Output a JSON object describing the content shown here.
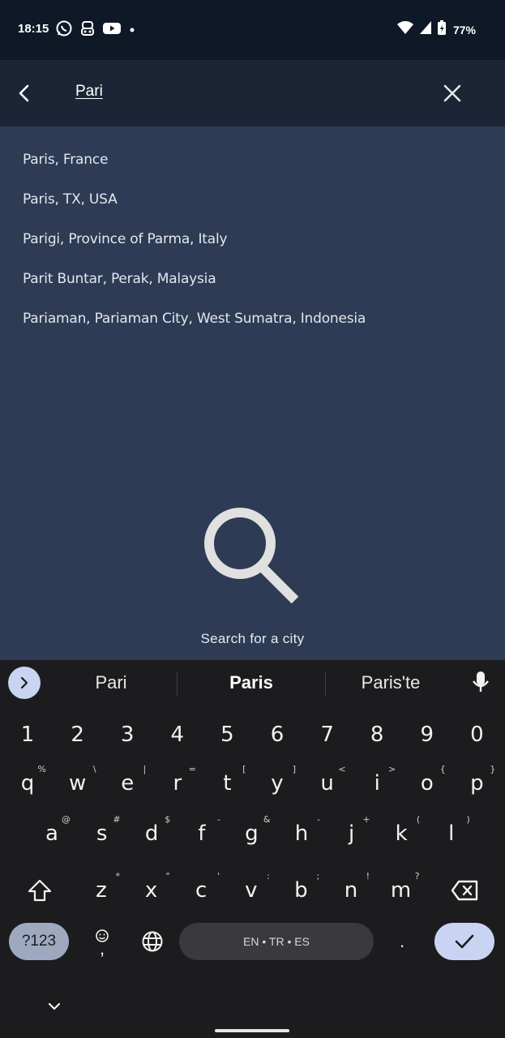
{
  "status_bar": {
    "time": "18:15",
    "battery": "77%",
    "left_icons": [
      "whatsapp-icon",
      "incognito-icon",
      "youtube-icon",
      "dot-icon"
    ],
    "right_icons": [
      "wifi-icon",
      "signal-icon",
      "battery-charging-icon"
    ]
  },
  "search": {
    "query": "Pari"
  },
  "results": [
    "Paris, France",
    "Paris, TX, USA",
    "Parigi, Province of Parma, Italy",
    "Parit Buntar, Perak, Malaysia",
    "Pariaman, Pariaman City, West Sumatra, Indonesia"
  ],
  "empty_state": {
    "text": "Search for a city"
  },
  "keyboard": {
    "suggestions": [
      "Pari",
      "Paris",
      "Paris'te"
    ],
    "numbers": [
      "1",
      "2",
      "3",
      "4",
      "5",
      "6",
      "7",
      "8",
      "9",
      "0"
    ],
    "row1": [
      {
        "k": "q",
        "h": "%"
      },
      {
        "k": "w",
        "h": "\\"
      },
      {
        "k": "e",
        "h": "|"
      },
      {
        "k": "r",
        "h": "="
      },
      {
        "k": "t",
        "h": "["
      },
      {
        "k": "y",
        "h": "]"
      },
      {
        "k": "u",
        "h": "<"
      },
      {
        "k": "i",
        "h": ">"
      },
      {
        "k": "o",
        "h": "{"
      },
      {
        "k": "p",
        "h": "}"
      }
    ],
    "row2": [
      {
        "k": "a",
        "h": "@"
      },
      {
        "k": "s",
        "h": "#"
      },
      {
        "k": "d",
        "h": "$"
      },
      {
        "k": "f",
        "h": "-"
      },
      {
        "k": "g",
        "h": "&"
      },
      {
        "k": "h",
        "h": "-"
      },
      {
        "k": "j",
        "h": "+"
      },
      {
        "k": "k",
        "h": "("
      },
      {
        "k": "l",
        "h": ")"
      }
    ],
    "row3": [
      {
        "k": "z",
        "h": "*"
      },
      {
        "k": "x",
        "h": "\""
      },
      {
        "k": "c",
        "h": "'"
      },
      {
        "k": "v",
        "h": ":"
      },
      {
        "k": "b",
        "h": ";"
      },
      {
        "k": "n",
        "h": "!"
      },
      {
        "k": "m",
        "h": "?"
      }
    ],
    "symbols_key": "?123",
    "space_label": "EN • TR • ES",
    "period": ".",
    "emoji_comma": ","
  }
}
